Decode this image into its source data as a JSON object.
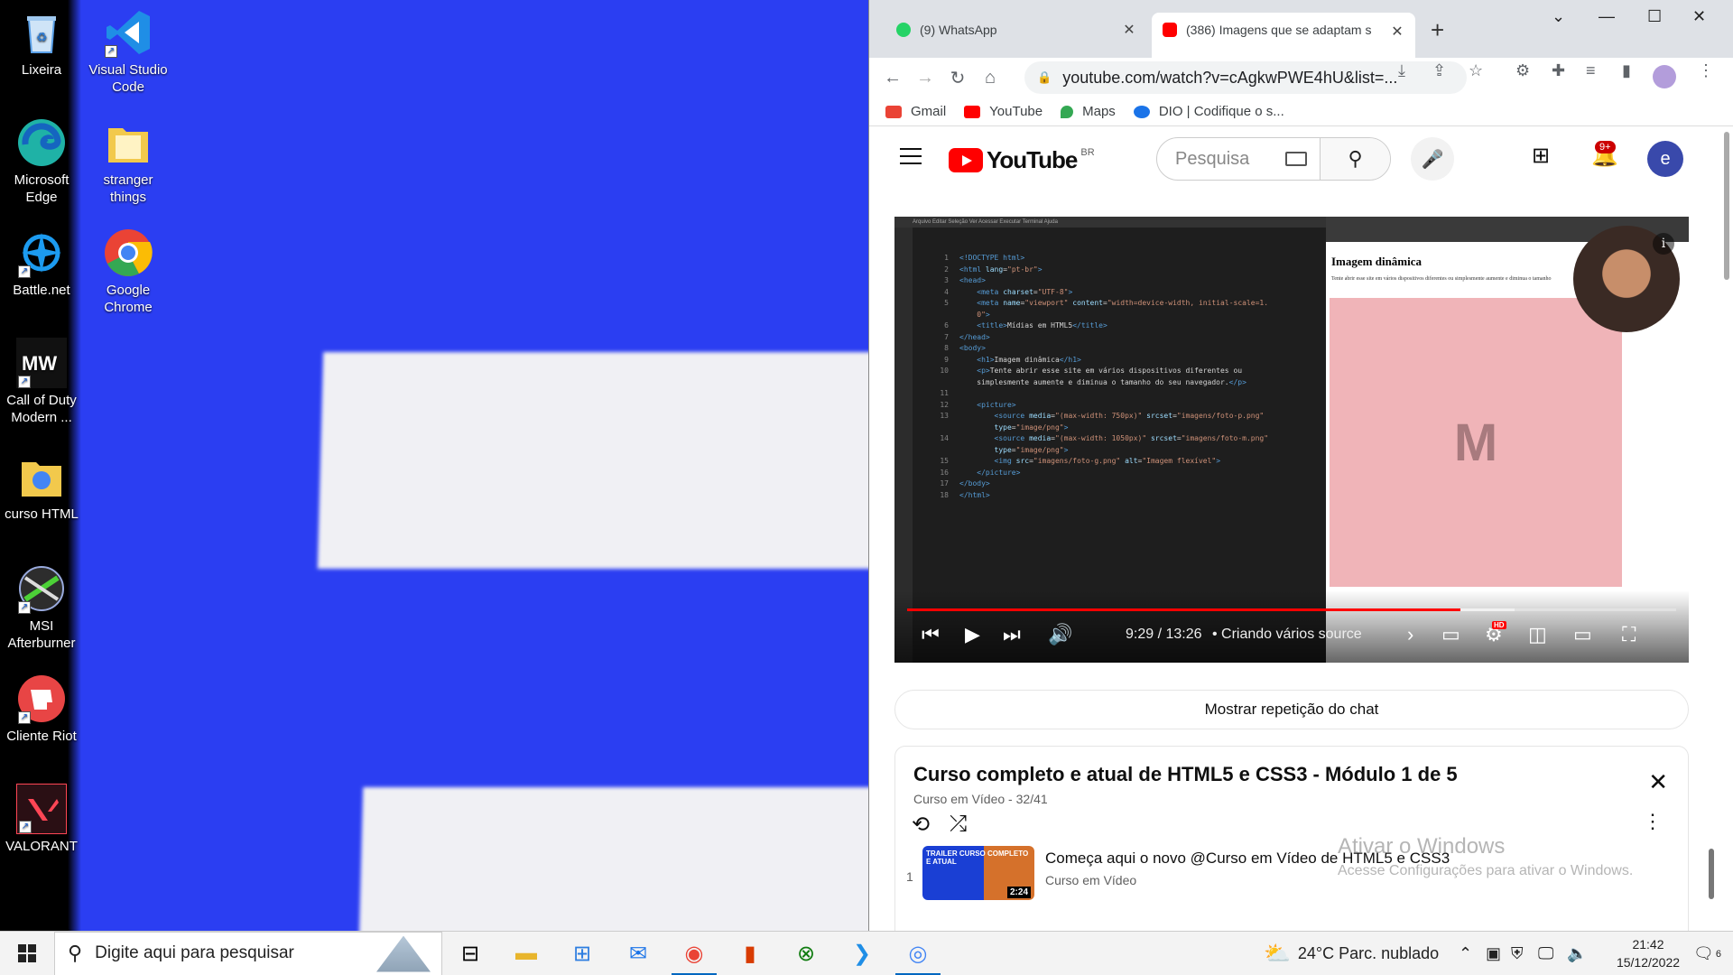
{
  "desktop": {
    "icons": [
      {
        "label": "Lixeira",
        "icon": "recycle-bin-icon",
        "color": "#5aa0e8"
      },
      {
        "label": "Visual Studio Code",
        "icon": "vscode-icon",
        "color": "#1f8ee6"
      },
      {
        "label": "Microsoft Edge",
        "icon": "edge-icon",
        "color": "#1fb2a6"
      },
      {
        "label": "stranger things",
        "icon": "folder-icon",
        "color": "#f2c94c"
      },
      {
        "label": "Battle.net",
        "icon": "battlenet-icon",
        "color": "#1c9bf0"
      },
      {
        "label": "Google Chrome",
        "icon": "chrome-icon",
        "color": "#4285f4"
      },
      {
        "label": "Call of Duty Modern ...",
        "icon": "call-of-duty-icon",
        "color": "#111111"
      },
      {
        "label": "curso HTML",
        "icon": "folder-icon",
        "color": "#f2c94c"
      },
      {
        "label": "MSI Afterburner",
        "icon": "msi-afterburner-icon",
        "color": "#3a9d3a"
      },
      {
        "label": "Cliente Riot",
        "icon": "riot-client-icon",
        "color": "#e84545"
      },
      {
        "label": "VALORANT",
        "icon": "valorant-icon",
        "color": "#ff4655"
      }
    ]
  },
  "browser": {
    "tabs": [
      {
        "title": "(9) WhatsApp",
        "icon": "whatsapp-icon",
        "color": "#25d366",
        "active": false
      },
      {
        "title": "(386) Imagens que se adaptam s",
        "icon": "youtube-icon",
        "color": "#ff0000",
        "active": true
      }
    ],
    "url": "youtube.com/watch?v=cAgkwPWE4hU&list=...",
    "bookmarks": [
      {
        "label": "Gmail",
        "icon": "gmail-icon",
        "color": "#ea4335"
      },
      {
        "label": "YouTube",
        "icon": "youtube-icon",
        "color": "#ff0000"
      },
      {
        "label": "Maps",
        "icon": "maps-icon",
        "color": "#34a853"
      },
      {
        "label": "DIO | Codifique o s...",
        "icon": "dio-icon",
        "color": "#1a73e8"
      }
    ]
  },
  "youtube": {
    "logo_text": "YouTube",
    "country": "BR",
    "search_placeholder": "Pesquisa",
    "notifications": "9+",
    "avatar_letter": "e",
    "player": {
      "time": "9:29 / 13:26",
      "chapter": "• Criando vários source",
      "played_fraction": 0.72,
      "buffered_fraction": 0.79,
      "hd_badge": "HD",
      "video_page_heading": "Imagem dinâmica",
      "video_page_text": "Tente abrir esse site em vários dispositivos diferentes ou simplesmente aumente e diminua o tamanho",
      "image_letter": "M"
    },
    "chat_replay": "Mostrar repetição do chat",
    "playlist": {
      "title": "Curso completo e atual de HTML5 e CSS3 - Módulo 1 de 5",
      "channel": "Curso em Vídeo",
      "position": "32/41",
      "items": [
        {
          "index": "1",
          "title": "Começa aqui o novo @Curso em Vídeo de HTML5 e CSS3",
          "channel": "Curso em Vídeo",
          "duration": "2:24",
          "thumb_text": "TRAILER CURSO COMPLETO E ATUAL"
        }
      ]
    }
  },
  "watermark": {
    "line1": "Ativar o Windows",
    "line2": "Acesse Configurações para ativar o Windows."
  },
  "taskbar": {
    "search_placeholder": "Digite aqui para pesquisar",
    "weather": "24°C  Parc. nublado",
    "time": "21:42",
    "date": "15/12/2022",
    "notification_count": "6"
  }
}
